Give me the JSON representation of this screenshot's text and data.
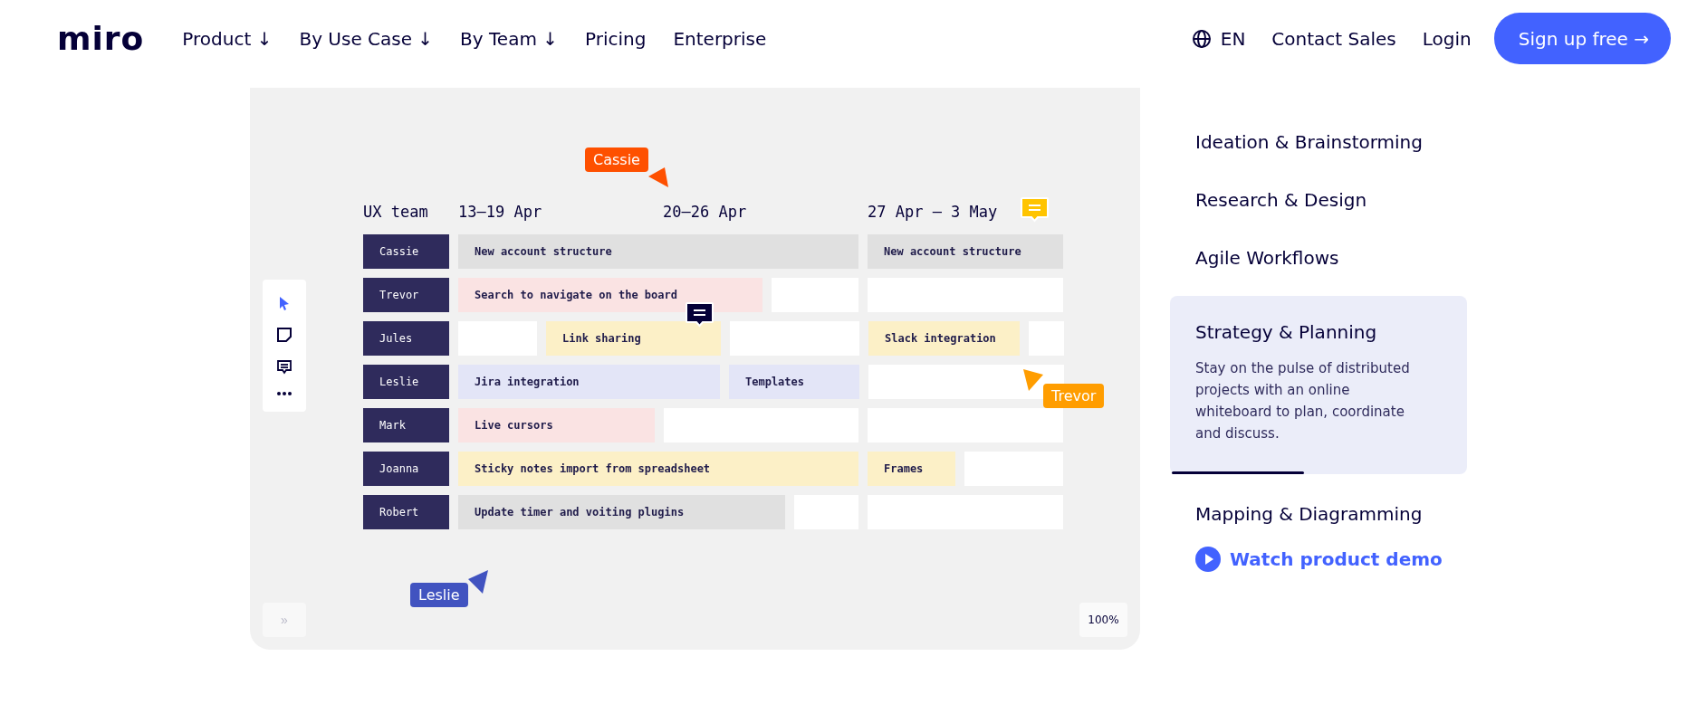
{
  "header": {
    "logo": "miro",
    "nav": [
      "Product ↓",
      "By Use Case ↓",
      "By Team ↓",
      "Pricing",
      "Enterprise"
    ],
    "language": "EN",
    "contact": "Contact Sales",
    "login": "Login",
    "signup": "Sign up free →"
  },
  "board": {
    "team": "UX team",
    "weeks": [
      "13–19 Apr",
      "20–26 Apr",
      "27 Apr – 3 May"
    ],
    "rows": [
      {
        "name": "Cassie",
        "segments": [
          {
            "kind": "task",
            "text": "New account structure",
            "color": "#e0e0e0"
          },
          {
            "kind": "task",
            "text": "New account structure",
            "color": "#e0e0e0"
          }
        ]
      },
      {
        "name": "Trevor",
        "segments": [
          {
            "kind": "task",
            "text": "Search to navigate on the board",
            "color": "#fae3e3"
          },
          {
            "kind": "empty"
          },
          {
            "kind": "empty"
          }
        ]
      },
      {
        "name": "Jules",
        "segments": [
          {
            "kind": "empty"
          },
          {
            "kind": "task",
            "text": "Link sharing",
            "color": "#fcf0c7"
          },
          {
            "kind": "empty"
          },
          {
            "kind": "task",
            "text": "Slack integration",
            "color": "#fcf0c7"
          },
          {
            "kind": "empty"
          }
        ]
      },
      {
        "name": "Leslie",
        "segments": [
          {
            "kind": "task",
            "text": "Jira integration",
            "color": "#e3e5f7"
          },
          {
            "kind": "task",
            "text": "Templates",
            "color": "#e3e5f7"
          },
          {
            "kind": "empty"
          }
        ]
      },
      {
        "name": "Mark",
        "segments": [
          {
            "kind": "task",
            "text": "Live cursors",
            "color": "#fae3e3"
          },
          {
            "kind": "empty"
          },
          {
            "kind": "empty"
          }
        ]
      },
      {
        "name": "Joanna",
        "segments": [
          {
            "kind": "task",
            "text": "Sticky notes import from spreadsheet",
            "color": "#fcf0c7"
          },
          {
            "kind": "task",
            "text": "Frames",
            "color": "#fcf0c7"
          },
          {
            "kind": "empty"
          }
        ]
      },
      {
        "name": "Robert",
        "segments": [
          {
            "kind": "task",
            "text": "Update timer and voiting plugins",
            "color": "#e0e0e0"
          },
          {
            "kind": "empty"
          },
          {
            "kind": "empty"
          }
        ]
      }
    ],
    "cursors": [
      {
        "name": "Cassie",
        "color": "#fe5000"
      },
      {
        "name": "Trevor",
        "color": "#ff9d00"
      },
      {
        "name": "Leslie",
        "color": "#4153c0"
      }
    ],
    "comments": [
      {
        "color": "#050038"
      },
      {
        "color": "#ffc400"
      }
    ],
    "expand": "»",
    "zoom": "100%"
  },
  "use_cases": {
    "items": [
      {
        "title": "Ideation & Brainstorming",
        "selected": false
      },
      {
        "title": "Research & Design",
        "selected": false
      },
      {
        "title": "Agile Workflows",
        "selected": false
      },
      {
        "title": "Strategy & Planning",
        "selected": true,
        "description": "Stay on the pulse of distributed projects with an online whiteboard to plan, coordinate and discuss.",
        "level": 0.45
      },
      {
        "title": "Mapping & Diagramming",
        "selected": false
      }
    ],
    "demo": "Watch product demo"
  }
}
